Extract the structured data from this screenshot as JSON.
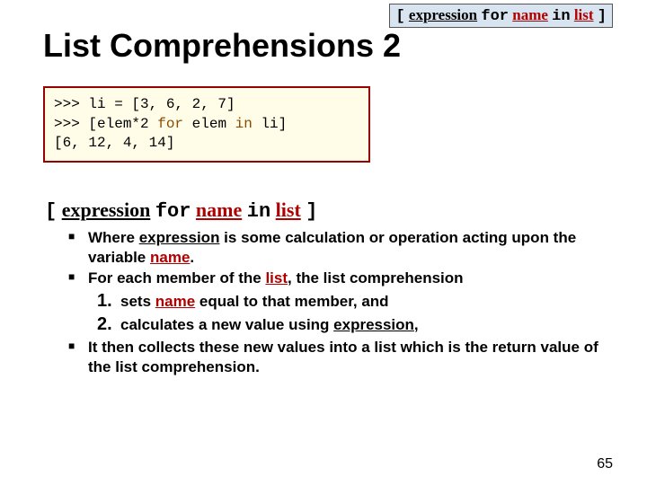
{
  "syntax": {
    "lbracket": "[",
    "expression": "expression",
    "for": "for",
    "name": "name",
    "in": "in",
    "list": "list",
    "rbracket": "]"
  },
  "title": "List Comprehensions 2",
  "code": {
    "line1a": ">>> li = [3, 6, 2, 7]",
    "line2a": ">>> [elem*2 ",
    "line2for": "for",
    "line2b": " elem ",
    "line2in": "in",
    "line2c": " li]",
    "line3": "[6, 12, 4, 14]"
  },
  "bullets": {
    "b1a": "Where ",
    "b1b": " is some calculation or operation acting upon the variable ",
    "b1c": ".",
    "b2a": "For each member of the ",
    "b2b": ", the list comprehension",
    "n1num": "1.",
    "n1a": "sets ",
    "n1b": " equal to that member, and",
    "n2num": "2.",
    "n2a": "calculates a new value using ",
    "n2b": ",",
    "b3": "It then collects these new values into a list which is the return value of the list comprehension."
  },
  "pagenum": "65"
}
